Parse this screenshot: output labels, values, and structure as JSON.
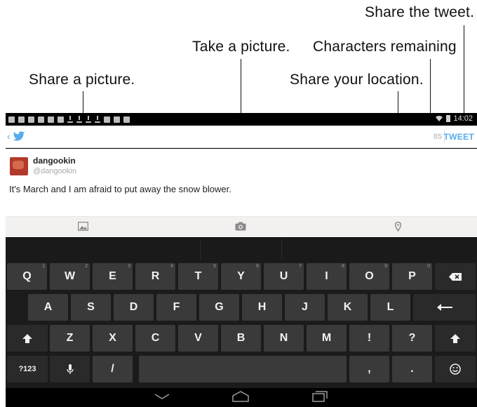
{
  "callouts": {
    "share_tweet": "Share the tweet.",
    "take_picture": "Take a picture.",
    "chars_remaining": "Characters remaining",
    "share_picture": "Share a picture.",
    "share_location": "Share your location."
  },
  "status": {
    "time": "14:02"
  },
  "actionbar": {
    "back": "‹",
    "chars_remaining": "85",
    "tweet_label": "TWEET"
  },
  "compose": {
    "username": "dangookin",
    "handle": "@dangookin",
    "text": "It's March and I am afraid to put away the snow blower."
  },
  "keyboard": {
    "row1": [
      {
        "k": "Q",
        "n": "1"
      },
      {
        "k": "W",
        "n": "2"
      },
      {
        "k": "E",
        "n": "3"
      },
      {
        "k": "R",
        "n": "4"
      },
      {
        "k": "T",
        "n": "5"
      },
      {
        "k": "Y",
        "n": "6"
      },
      {
        "k": "U",
        "n": "7"
      },
      {
        "k": "I",
        "n": "8"
      },
      {
        "k": "O",
        "n": "9"
      },
      {
        "k": "P",
        "n": "0"
      }
    ],
    "row2": [
      "A",
      "S",
      "D",
      "F",
      "G",
      "H",
      "J",
      "K",
      "L"
    ],
    "row3": [
      "Z",
      "X",
      "C",
      "V",
      "B",
      "N",
      "M",
      "!",
      "?"
    ],
    "symbols_key": "?123",
    "slash_key": "/",
    "comma_key": ",",
    "period_key": "."
  },
  "colors": {
    "accent": "#55acee",
    "key": "#3a3a3a",
    "keyboard_bg": "#1b1b1b"
  }
}
